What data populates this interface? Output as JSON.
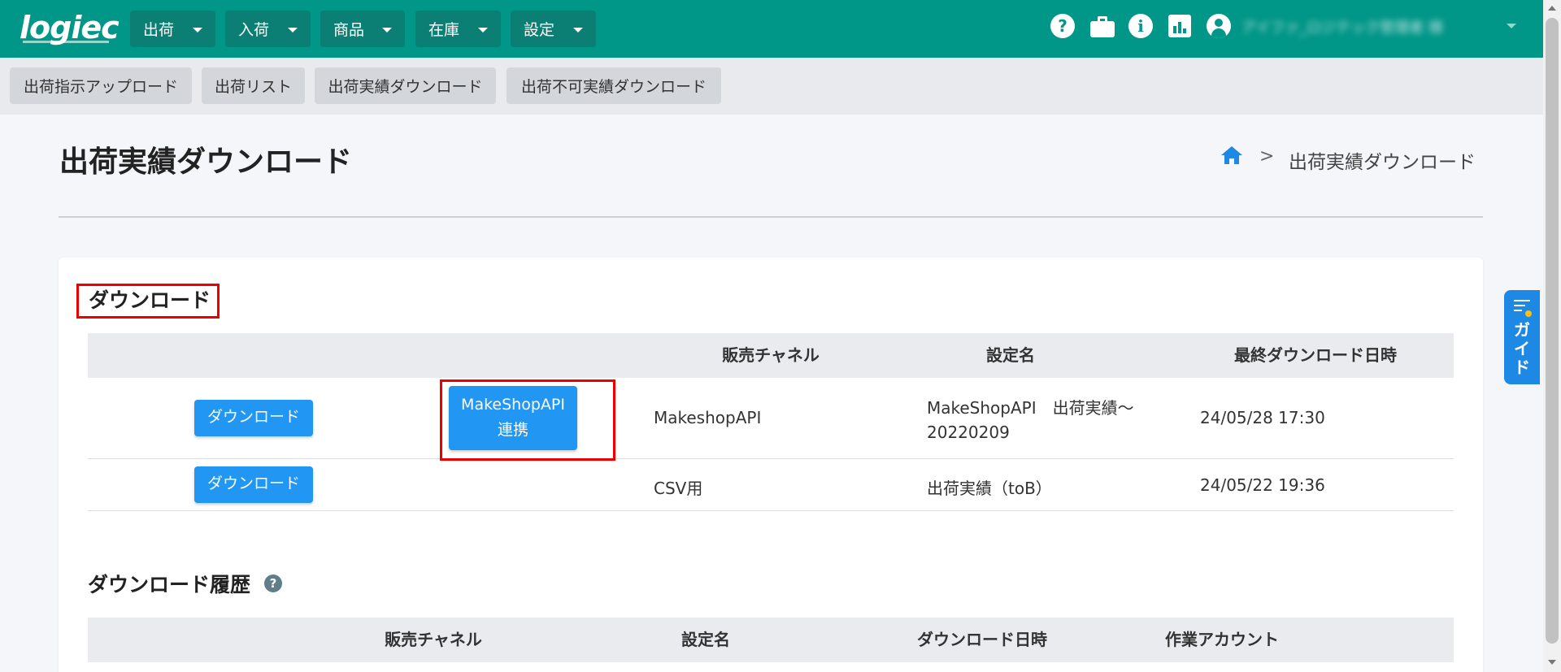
{
  "brand": {
    "logo": "logiec"
  },
  "topnav": {
    "menus": [
      {
        "label": "出荷"
      },
      {
        "label": "入荷"
      },
      {
        "label": "商品"
      },
      {
        "label": "在庫"
      },
      {
        "label": "設定"
      }
    ],
    "icons": [
      "help-icon",
      "briefcase-icon",
      "info-icon",
      "chart-icon",
      "account-icon"
    ],
    "user_name": "アイファ_ロジテック管理者 様"
  },
  "subnav": {
    "items": [
      {
        "label": "出荷指示アップロード"
      },
      {
        "label": "出荷リスト"
      },
      {
        "label": "出荷実績ダウンロード"
      },
      {
        "label": "出荷不可実績ダウンロード"
      }
    ]
  },
  "page": {
    "title": "出荷実績ダウンロード",
    "breadcrumb": {
      "separator": ">",
      "current": "出荷実績ダウンロード"
    }
  },
  "download_section": {
    "title": "ダウンロード",
    "columns": [
      "販売チャネル",
      "設定名",
      "最終ダウンロード日時"
    ],
    "rows": [
      {
        "button": "ダウンロード",
        "api_button": "MakeShopAPI連携",
        "channel": "MakeshopAPI",
        "setting_name": "MakeShopAPI　出荷実績～20220209",
        "last_download": "24/05/28 17:30"
      },
      {
        "button": "ダウンロード",
        "channel": "CSV用",
        "setting_name": "出荷実績（toB）",
        "last_download": "24/05/22 19:36"
      }
    ]
  },
  "history_section": {
    "title": "ダウンロード履歴",
    "help": "?",
    "columns": [
      "販売チャネル",
      "設定名",
      "ダウンロード日時",
      "作業アカウント"
    ]
  },
  "guide_tab": {
    "label": "ガイド"
  },
  "colors": {
    "header": "#009688",
    "primary_button": "#2196f3",
    "highlight": "#ee0000"
  }
}
